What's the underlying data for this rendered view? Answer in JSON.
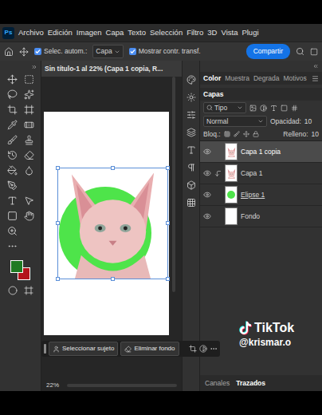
{
  "app": {
    "logo": "Ps"
  },
  "menu": [
    "Archivo",
    "Edición",
    "Imagen",
    "Capa",
    "Texto",
    "Selección",
    "Filtro",
    "3D",
    "Vista",
    "Plugi"
  ],
  "options_bar": {
    "auto_select": {
      "label": "Selec. autom.:",
      "checked": true
    },
    "target": "Capa",
    "show_transform": {
      "label": "Mostrar contr. transf.",
      "checked": true
    },
    "share": "Compartir"
  },
  "document_tab": {
    "title": "Sin título-1 al 22% (Capa 1 copia, R...",
    "close": "×"
  },
  "swatches": [
    {
      "color": "#1f7a22"
    },
    {
      "color": "#b3151b"
    }
  ],
  "task_bar": [
    "Seleccionar sujeto",
    "Eliminar fondo"
  ],
  "status_bar": {
    "zoom": "22%"
  },
  "panel_tabs": [
    {
      "label": "Color",
      "selected": true
    },
    {
      "label": "Muestra",
      "selected": false
    },
    {
      "label": "Degrada",
      "selected": false
    },
    {
      "label": "Motivos",
      "selected": false
    }
  ],
  "layers_panel": {
    "tab": "Capas",
    "filter": "Tipo",
    "blend_mode": "Normal",
    "opacity_label": "Opacidad:",
    "opacity": "10",
    "lock_label": "Bloq.:",
    "fill_label": "Relleno:",
    "fill": "10",
    "layers": [
      {
        "name": "Capa 1 copia",
        "visible": true,
        "selected": true,
        "clipped": false,
        "underlined": false,
        "kind": "photo"
      },
      {
        "name": "Capa 1",
        "visible": true,
        "selected": false,
        "clipped": true,
        "underlined": false,
        "kind": "photo"
      },
      {
        "name": "Elipse 1",
        "visible": true,
        "selected": false,
        "clipped": false,
        "underlined": true,
        "kind": "shape"
      },
      {
        "name": "Fondo",
        "visible": true,
        "selected": false,
        "clipped": false,
        "underlined": false,
        "kind": "fill"
      }
    ]
  },
  "bottom_tabs": [
    {
      "label": "Canales",
      "selected": false
    },
    {
      "label": "Trazados",
      "selected": true
    }
  ],
  "watermark": {
    "brand": "TikTok",
    "handle": "@krismar.o"
  }
}
